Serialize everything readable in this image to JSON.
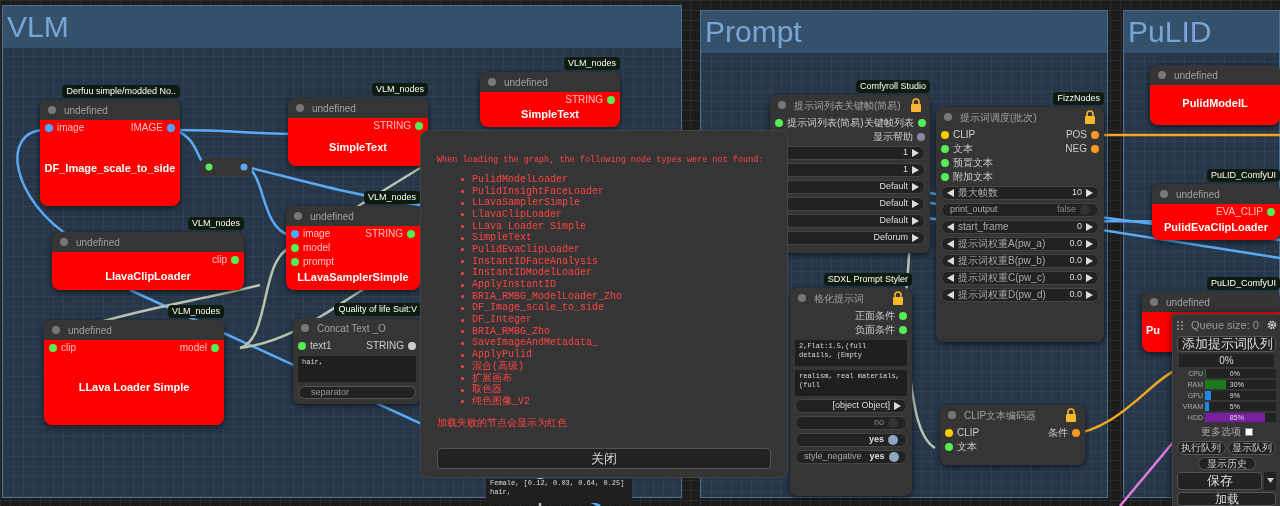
{
  "groups": [
    {
      "title": "VLM"
    },
    {
      "title": "Prompt"
    },
    {
      "title": "PuLID"
    }
  ],
  "nodes": [
    {
      "badge": "Derfuu simple/modded No..",
      "title": "undefined",
      "name": "DF_Image_scale_to_side",
      "missing": true,
      "locked": false,
      "inputs": [
        {
          "label": "image",
          "color": "#4da6ff"
        }
      ],
      "outputs": [
        {
          "label": "IMAGE",
          "color": "#4da6ff"
        }
      ]
    },
    {
      "badge": "VLM_nodes",
      "title": "undefined",
      "name": "SimpleText",
      "missing": true,
      "locked": false,
      "outputs": [
        {
          "label": "STRING",
          "color": "#55ee55"
        }
      ]
    },
    {
      "badge": "VLM_nodes",
      "title": "undefined",
      "name": "SimpleText",
      "missing": true,
      "locked": false,
      "outputs": [
        {
          "label": "STRING",
          "color": "#55ee55"
        }
      ]
    },
    {
      "badge": "VLM_nodes",
      "title": "undefined",
      "name": "LlavaClipLoader",
      "missing": true,
      "locked": false,
      "outputs": [
        {
          "label": "clip",
          "color": "#55ee55"
        }
      ]
    },
    {
      "badge": "VLM_nodes",
      "title": "undefined",
      "name": "LLavaSamplerSimple",
      "missing": true,
      "locked": false,
      "inputs": [
        {
          "label": "image",
          "color": "#4da6ff"
        },
        {
          "label": "model",
          "color": "#55ee55"
        },
        {
          "label": "prompt",
          "color": "#55ee55"
        }
      ],
      "outputs": [
        {
          "label": "STRING",
          "color": "#55ee55"
        }
      ]
    },
    {
      "badge": "VLM_nodes",
      "title": "undefined",
      "name": "LLava Loader Simple",
      "missing": true,
      "locked": false,
      "inputs": [
        {
          "label": "clip",
          "color": "#55ee55"
        }
      ],
      "outputs": [
        {
          "label": "model",
          "color": "#55ee55"
        }
      ]
    },
    {
      "badge": "Quality of life Suit:V",
      "title": "Concat Text _O",
      "missing": false,
      "locked": false,
      "inputs": [
        {
          "label": "text1",
          "color": "#55ee55"
        }
      ],
      "outputs": [
        {
          "label": "STRING",
          "color": "#cccccc"
        }
      ],
      "widgets": [
        {
          "kind": "textarea",
          "value": "hair,"
        },
        {
          "kind": "text",
          "label": "separator"
        }
      ]
    },
    {
      "badge": "Comfyroll Studio",
      "title": "提示词列表关键帧(简易)",
      "missing": false,
      "locked": true,
      "inputs": [
        {
          "label": "提示词列表(简易)",
          "color": "#55ee55"
        }
      ],
      "outputs": [
        {
          "label": "关键帧列表",
          "color": "#55ee55"
        },
        {
          "label": "显示帮助",
          "color": "#8888aa"
        }
      ],
      "widgets": [
        {
          "kind": "number",
          "value": "1"
        },
        {
          "kind": "number",
          "value": "1"
        },
        {
          "kind": "combo",
          "value": "Default"
        },
        {
          "kind": "combo",
          "value": "Default"
        },
        {
          "kind": "combo",
          "value": "Default"
        },
        {
          "kind": "combo",
          "value": "Deforum"
        }
      ]
    },
    {
      "badge": "FizzNodes",
      "title": "提示词调度(批次)",
      "missing": false,
      "locked": true,
      "inputs": [
        {
          "label": "CLIP",
          "color": "#ffcc00"
        },
        {
          "label": "文本",
          "color": "#55ee55"
        },
        {
          "label": "预置文本",
          "color": "#55ee55"
        },
        {
          "label": "附加文本",
          "color": "#55ee55"
        }
      ],
      "outputs": [
        {
          "label": "POS",
          "color": "#ff9922"
        },
        {
          "label": "NEG",
          "color": "#ff9922"
        }
      ],
      "widgets": [
        {
          "kind": "number",
          "label": "最大帧数",
          "value": "10"
        },
        {
          "kind": "toggle",
          "label": "print_output",
          "value": "false",
          "on": false
        },
        {
          "kind": "number",
          "label": "start_frame",
          "value": "0"
        },
        {
          "kind": "number",
          "label": "提示词权重A(pw_a)",
          "value": "0.0"
        },
        {
          "kind": "number",
          "label": "提示词权重B(pw_b)",
          "value": "0.0"
        },
        {
          "kind": "number",
          "label": "提示词权重C(pw_c)",
          "value": "0.0"
        },
        {
          "kind": "number",
          "label": "提示词权重D(pw_d)",
          "value": "0.0"
        }
      ]
    },
    {
      "badge": "SDXL Prompt Styler",
      "title": "格化提示词",
      "missing": false,
      "locked": true,
      "outputs": [
        {
          "label": "正面条件",
          "color": "#55ee55"
        },
        {
          "label": "负面条件",
          "color": "#55ee55"
        }
      ],
      "widgets": [
        {
          "kind": "textarea",
          "value": "2,Flat:1.5,(full\ndetails, (Empty"
        },
        {
          "kind": "textarea",
          "value": "realism, real materials, (full"
        },
        {
          "kind": "combo",
          "value": "[object Object]"
        },
        {
          "kind": "toggle",
          "value": "no",
          "on": false
        },
        {
          "kind": "toggle",
          "value": "yes",
          "on": true
        },
        {
          "kind": "toggle",
          "label": "style_negative",
          "value": "yes",
          "on": true
        }
      ]
    },
    {
      "title": "CLIP文本编码器",
      "missing": false,
      "locked": true,
      "inputs": [
        {
          "label": "CLIP",
          "color": "#ffcc00"
        },
        {
          "label": "文本",
          "color": "#55ee55"
        }
      ],
      "outputs": [
        {
          "label": "条件",
          "color": "#ff9922"
        }
      ]
    },
    {
      "title": "undefined",
      "name": "PulidModelL",
      "missing": true,
      "locked": false
    },
    {
      "badge": "PuLID_ComfyUI",
      "title": "undefined",
      "name": "PulidEvaClipLoader",
      "missing": true,
      "locked": false,
      "outputs": [
        {
          "label": "EVA_CLIP",
          "color": "#55ee55"
        }
      ]
    },
    {
      "badge": "PuLID_ComfyUI",
      "title": "undefined",
      "name": "Pu",
      "missing": true,
      "locked": false
    }
  ],
  "node_fragment": {
    "lines": [
      "Female, [0.12, 0.03, 0.64, 0.25]",
      "hair,"
    ]
  },
  "dialog": {
    "message": "When loading the graph, the following node types were not found:",
    "items": [
      "PulidModelLoader",
      "PulidInsightFaceLoader",
      "LLavaSamplerSimple",
      "LlavaClipLoader",
      "LLava Loader Simple",
      "SimpleText",
      "PulidEvaClipLoader",
      "InstantIDFaceAnalysis",
      "InstantIDModelLoader",
      "ApplyInstantID",
      "BRIA_RMBG_ModelLoader_Zho",
      "DF_Image_scale_to_side",
      "DF_Integer",
      "BRIA_RMBG_Zho",
      "SaveImageAndMetadata_",
      "ApplyPulid",
      "混合(高级)",
      "扩展画布",
      "取色器",
      "纯色图像_V2"
    ],
    "note": "加载失败的节点会显示为红色",
    "close": "关闭"
  },
  "queue_panel": {
    "queue_size": "Queue size: 0",
    "queue_button": "添加提示词队列",
    "progress": {
      "text": "0%",
      "level": 0
    },
    "stats": [
      {
        "label": "CPU",
        "value": "0%",
        "level": 0,
        "color": "#1a7a1a"
      },
      {
        "label": "RAM",
        "value": "30%",
        "level": 0.3,
        "color": "#1a7a1a"
      },
      {
        "label": "GPU",
        "value": "9%",
        "level": 0.09,
        "color": "#1e88e5"
      },
      {
        "label": "VRAM",
        "value": "5%",
        "level": 0.05,
        "color": "#1e88e5"
      },
      {
        "label": "HDD",
        "value": "85%",
        "level": 0.85,
        "color": "#7b1fa2"
      }
    ],
    "more_options": {
      "label": "更多选项",
      "checked": false
    },
    "buttons": [
      "执行队列",
      "显示队列"
    ],
    "history_button": "显示历史",
    "save": "保存",
    "load": "加载"
  }
}
